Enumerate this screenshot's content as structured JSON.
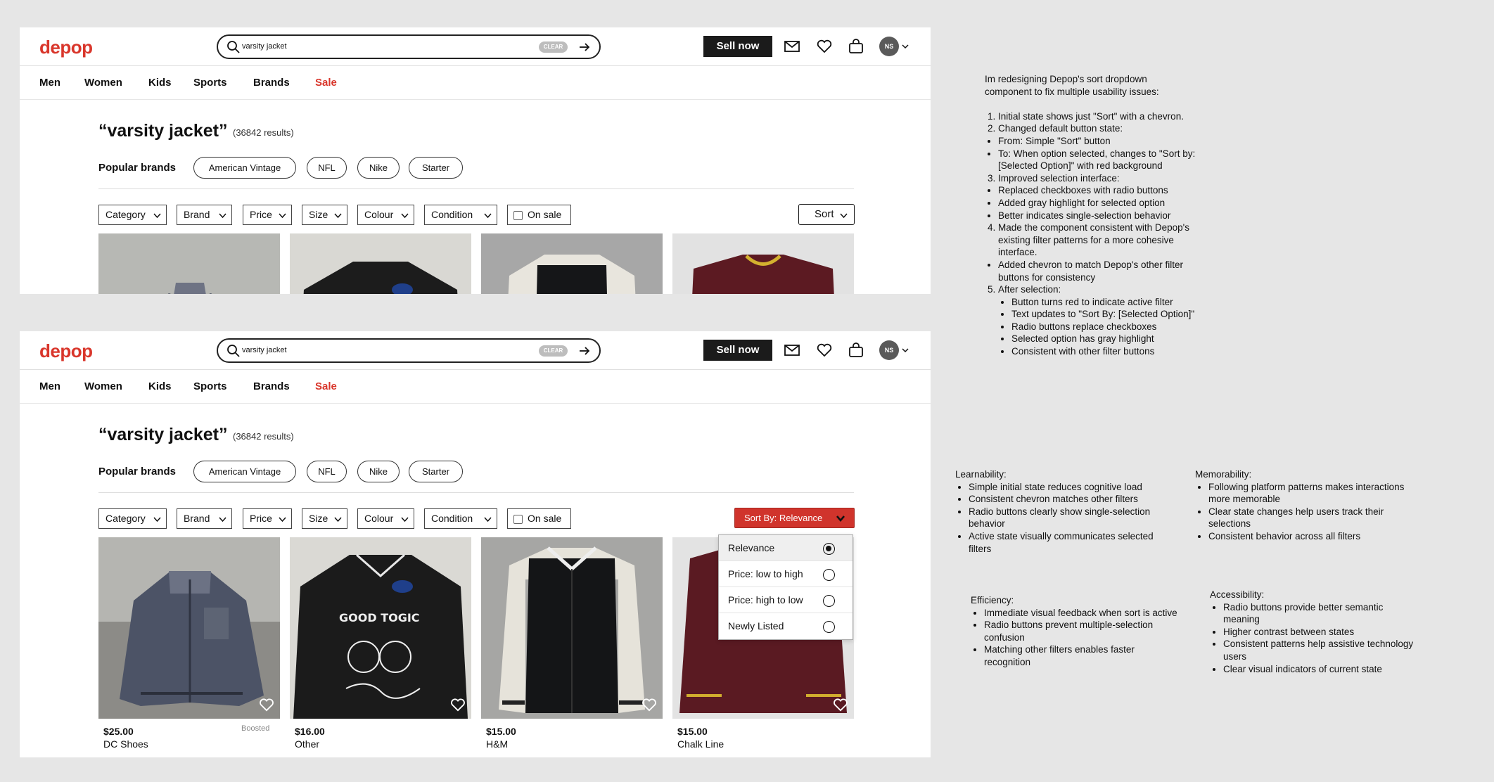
{
  "header": {
    "logo": "depop",
    "search_value": "varsity jacket",
    "clear_label": "CLEAR",
    "sell_label": "Sell now",
    "avatar_initials": "NS"
  },
  "nav": {
    "items": [
      "Men",
      "Women",
      "Kids",
      "Sports",
      "Brands"
    ],
    "sale": "Sale"
  },
  "results": {
    "title": "“varsity jacket”",
    "count": "(36842 results)"
  },
  "popular_brands": {
    "label": "Popular brands",
    "chips": [
      "American Vintage",
      "NFL",
      "Nike",
      "Starter"
    ]
  },
  "filters": {
    "items": [
      "Category",
      "Brand",
      "Price",
      "Size",
      "Colour",
      "Condition"
    ],
    "on_sale": "On sale",
    "sort_default": "Sort",
    "sort_active": "Sort By: Relevance"
  },
  "sort_options": [
    {
      "label": "Relevance",
      "selected": true
    },
    {
      "label": "Price: low to high",
      "selected": false
    },
    {
      "label": "Price: high to low",
      "selected": false
    },
    {
      "label": "Newly Listed",
      "selected": false
    }
  ],
  "products": [
    {
      "price": "$25.00",
      "brand": "DC Shoes",
      "badge": "Boosted"
    },
    {
      "price": "$16.00",
      "brand": "Other",
      "badge": ""
    },
    {
      "price": "$15.00",
      "brand": "H&M",
      "badge": ""
    },
    {
      "price": "$15.00",
      "brand": "Chalk Line",
      "badge": ""
    }
  ],
  "notes": {
    "intro": "Im redesigning Depop's sort dropdown component to fix multiple usability issues:",
    "s1": "Initial state shows just \"Sort\" with a chevron.",
    "s2": "Changed default button state:",
    "s2_b1": "From: Simple \"Sort\" button",
    "s2_b2": " To: When option selected, changes to \"Sort by: [Selected Option]\" with red background",
    "s3": " Improved selection interface:",
    "s3_b1": "Replaced checkboxes with radio buttons",
    "s3_b2": "Added gray highlight for selected option",
    "s3_b3": "Better indicates single-selection behavior",
    "s4": "Made the component consistent with Depop's existing filter patterns for a more cohesive interface.",
    "s4_b1": "Added chevron to match Depop's other filter buttons for consistency",
    "s5": "After selection:",
    "s5_b1": "Button turns red to indicate active filter",
    "s5_b2": "Text updates to \"Sort By: [Selected Option]\"",
    "s5_b3": "Radio buttons replace checkboxes",
    "s5_b4": "Selected option has gray highlight",
    "s5_b5": "Consistent with other filter buttons",
    "learnability_title": "Learnability:",
    "learnability": [
      "Simple initial state reduces cognitive load",
      "Consistent chevron matches other filters",
      "Radio buttons clearly show single-selection behavior",
      "Active state visually communicates selected filters"
    ],
    "memorability_title": "Memorability:",
    "memorability": [
      "Following platform patterns makes interactions more memorable",
      "Clear state changes help users track their selections",
      "Consistent behavior across all filters"
    ],
    "efficiency_title": "Efficiency:",
    "efficiency": [
      "Immediate visual feedback when sort is active",
      "Radio buttons prevent multiple-selection confusion",
      "Matching other filters enables faster recognition"
    ],
    "accessibility_title": "Accessibility:",
    "accessibility": [
      "Radio buttons provide better semantic meaning",
      "Higher contrast between states",
      "Consistent patterns help assistive technology users",
      "Clear visual indicators of current state"
    ]
  }
}
